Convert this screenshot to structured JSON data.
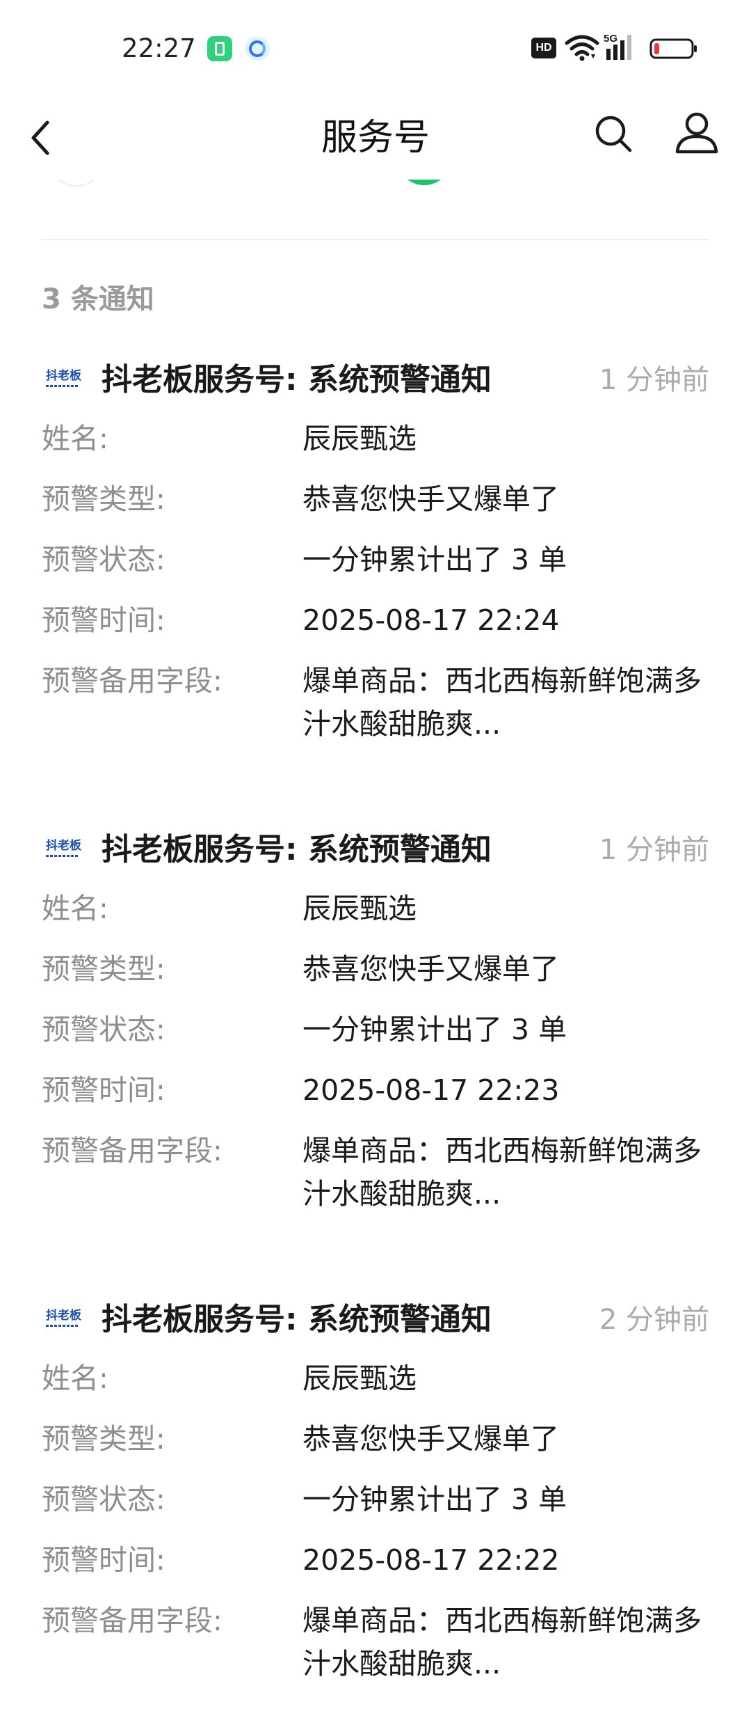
{
  "status_bar": {
    "time": "22:27",
    "hd": "HD",
    "network": "5G",
    "icons": [
      "battery-saver-app-icon",
      "browser-app-icon",
      "wifi-icon",
      "signal-icon",
      "battery-icon"
    ]
  },
  "nav": {
    "title": "服务号",
    "back_icon": "chevron-left-icon",
    "search_icon": "search-icon",
    "profile_icon": "person-icon"
  },
  "notice_count": "3 条通知",
  "labels": {
    "name": "姓名:",
    "type": "预警类型:",
    "status": "预警状态:",
    "time": "预警时间:",
    "extra": "预警备用字段:"
  },
  "logo_text": "抖老板",
  "notifications": [
    {
      "title": "抖老板服务号:  系统预警通知",
      "time_ago": "1 分钟前",
      "name": "辰辰甄选",
      "type": "恭喜您快手又爆单了",
      "status": "一分钟累计出了 3 单",
      "time": "2025-08-17 22:24",
      "extra": "爆单商品：西北西梅新鲜饱满多汁水酸甜脆爽..."
    },
    {
      "title": "抖老板服务号:  系统预警通知",
      "time_ago": "1 分钟前",
      "name": "辰辰甄选",
      "type": "恭喜您快手又爆单了",
      "status": "一分钟累计出了 3 单",
      "time": "2025-08-17 22:23",
      "extra": "爆单商品：西北西梅新鲜饱满多汁水酸甜脆爽..."
    },
    {
      "title": "抖老板服务号:  系统预警通知",
      "time_ago": "2 分钟前",
      "name": "辰辰甄选",
      "type": "恭喜您快手又爆单了",
      "status": "一分钟累计出了 3 单",
      "time": "2025-08-17 22:22",
      "extra": "爆单商品：西北西梅新鲜饱满多汁水酸甜脆爽..."
    }
  ],
  "colors": {
    "label": "#8e8e8e",
    "value": "#1a1a1a",
    "muted": "#ababab",
    "logo": "#1e4fb0"
  }
}
